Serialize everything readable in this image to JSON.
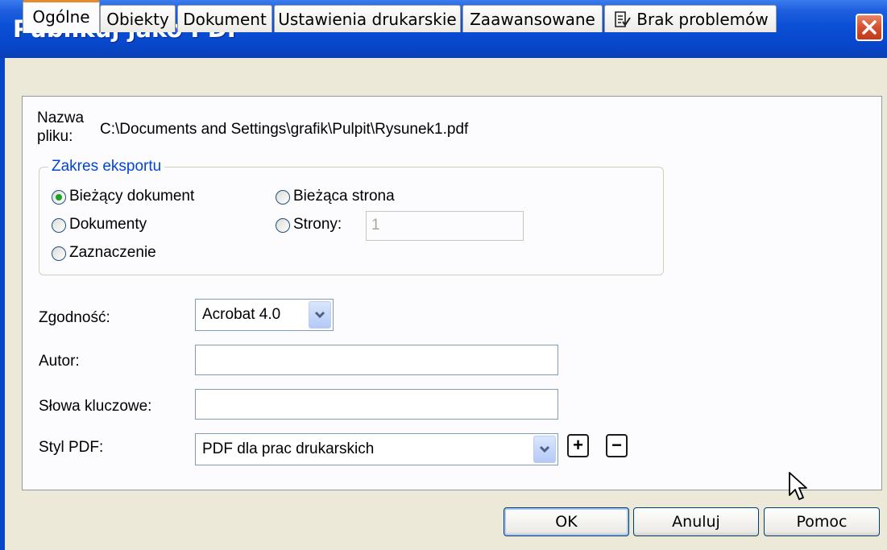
{
  "window": {
    "title": "Publikuj jako PDF"
  },
  "tabs": [
    {
      "label": "Ogólne"
    },
    {
      "label": "Obiekty"
    },
    {
      "label": "Dokument"
    },
    {
      "label": "Ustawienia drukarskie"
    },
    {
      "label": "Zaawansowane"
    },
    {
      "label": "Brak problemów",
      "icon": "checklist-icon"
    }
  ],
  "general": {
    "filename_label_line1": "Nazwa",
    "filename_label_line2": "pliku:",
    "filename_value": "C:\\Documents and Settings\\grafik\\Pulpit\\Rysunek1.pdf",
    "export_range": {
      "title": "Zakres eksportu",
      "options": {
        "current_document": "Bieżący dokument",
        "documents": "Dokumenty",
        "selection": "Zaznaczenie",
        "current_page": "Bieżąca strona",
        "pages": "Strony:"
      },
      "selected": "current_document",
      "pages_value": "1"
    },
    "compat_label": "Zgodność:",
    "compat_value": "Acrobat 4.0",
    "author_label": "Autor:",
    "author_value": "",
    "keywords_label": "Słowa kluczowe:",
    "keywords_value": "",
    "pdf_style_label": "Styl PDF:",
    "pdf_style_value": "PDF dla prac drukarskich",
    "add_style": "+",
    "remove_style": "−"
  },
  "buttons": {
    "ok": "OK",
    "cancel": "Anuluj",
    "help": "Pomoc"
  },
  "colors": {
    "titlebar": "#0a4fd6",
    "accent": "#0046d5",
    "radio_checked": "#21a121",
    "active_tab": "#e68b2c"
  }
}
